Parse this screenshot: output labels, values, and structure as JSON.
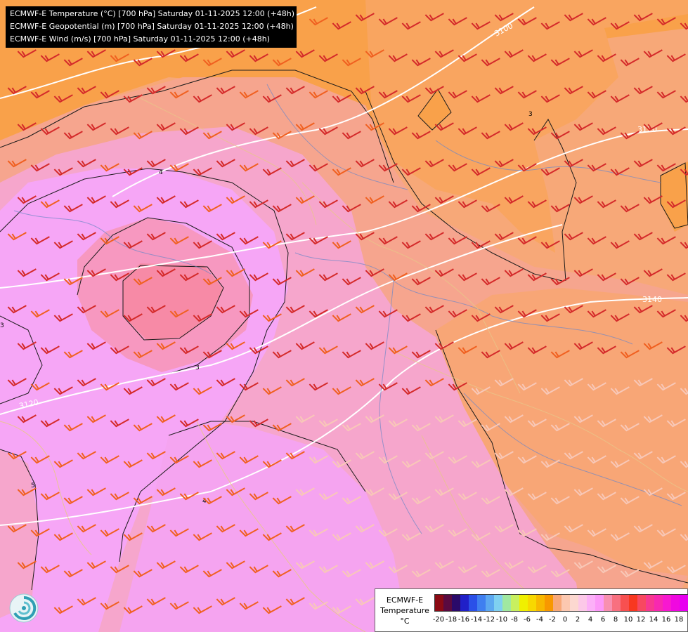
{
  "title_lines": [
    "ECMWF-E Temperature (°C) [700 hPa] Saturday 01-11-2025 12:00 (+48h)",
    "ECMWF-E Geopotential (m) [700 hPa] Saturday 01-11-2025 12:00 (+48h)",
    "ECMWF-E Wind (m/s) [700 hPa] Saturday 01-11-2025 12:00 (+48h)"
  ],
  "legend": {
    "title_line1": "ECMWF-E",
    "title_line2": "Temperature",
    "title_line3": "°C",
    "tick_labels": [
      "-20",
      "-18",
      "-16",
      "-14",
      "-12",
      "-10",
      "-8",
      "-6",
      "-4",
      "-2",
      "0",
      "2",
      "4",
      "6",
      "8",
      "10",
      "12",
      "14",
      "16",
      "18"
    ],
    "colors": [
      "#8b0a14",
      "#5a0a40",
      "#2a0a6a",
      "#2020c8",
      "#2a50e8",
      "#3f7ff0",
      "#5ca8f0",
      "#7fd0f0",
      "#a0e8a0",
      "#c8f060",
      "#f0f000",
      "#f8d800",
      "#f8b800",
      "#f89800",
      "#f8a878",
      "#fcc8b0",
      "#fcd8d0",
      "#fcc8e8",
      "#fcb0f8",
      "#fc98f8",
      "#f890b0",
      "#f87080",
      "#f85050",
      "#f83820",
      "#f84860",
      "#f83890",
      "#f828b0",
      "#f818d0",
      "#f008e0",
      "#e800f0"
    ]
  },
  "contour_labels": {
    "geopotential": [
      "3100",
      "3120",
      "3140",
      "3120"
    ],
    "temperature": [
      "4",
      "3",
      "3",
      "4",
      "5",
      "3"
    ]
  },
  "colors": {
    "orange_zone": "#f9a14a",
    "light_orange": "#f7a878",
    "salmon": "#f4a89a",
    "pink": "#f6a6cc",
    "magenta": "#f6a6f6",
    "warm_core": "#f78aa6",
    "barb_dark": "#d42a2a",
    "barb_orange": "#f06020",
    "barb_light": "#f8c8b8"
  }
}
